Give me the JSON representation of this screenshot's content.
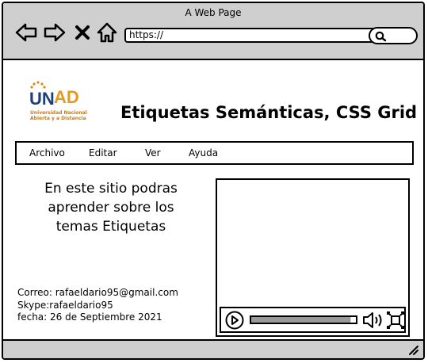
{
  "window": {
    "title": "A Web Page"
  },
  "browser": {
    "url": "https://"
  },
  "logo": {
    "text": "UNAD",
    "line1": "Universidad Nacional",
    "line2": "Abierta y a Distancia"
  },
  "page": {
    "title": "Etiquetas Semánticas, CSS Grid"
  },
  "menu": [
    "Archivo",
    "Editar",
    "Ver",
    "Ayuda"
  ],
  "intro": {
    "lines": [
      "En este sitio podras",
      "aprender sobre los",
      "temas Etiquetas"
    ]
  },
  "contact": {
    "email": "Correo: rafaeldario95@gmail.com",
    "skype": "Skype:rafaeldario95",
    "date": "fecha: 26 de Septiembre 2021"
  },
  "video": {
    "progress": 0.95
  }
}
